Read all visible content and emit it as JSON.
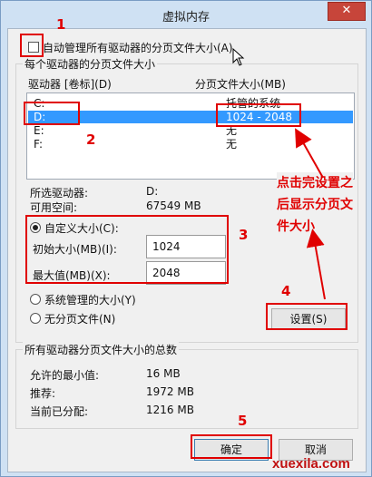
{
  "window": {
    "title": "虚拟内存",
    "close_label": "✕"
  },
  "auto_manage": {
    "label": "自动管理所有驱动器的分页文件大小(A)",
    "checked": false
  },
  "drive_group": {
    "title": "每个驱动器的分页文件大小",
    "col_drive": "驱动器 [卷标](D)",
    "col_size": "分页文件大小(MB)",
    "rows": [
      {
        "drive": "C:",
        "size": "托管的系统"
      },
      {
        "drive": "D:",
        "size": "1024 - 2048"
      },
      {
        "drive": "E:",
        "size": "无"
      },
      {
        "drive": "F:",
        "size": "无"
      }
    ],
    "selected_label": "所选驱动器:",
    "selected_value": "D:",
    "free_label": "可用空间:",
    "free_value": "67549 MB",
    "custom_label": "自定义大小(C):",
    "initial_label": "初始大小(MB)(I):",
    "initial_value": "1024",
    "max_label": "最大值(MB)(X):",
    "max_value": "2048",
    "system_label": "系统管理的大小(Y)",
    "none_label": "无分页文件(N)",
    "set_button": "设置(S)"
  },
  "totals_group": {
    "title": "所有驱动器分页文件大小的总数",
    "min_label": "允许的最小值:",
    "min_value": "16 MB",
    "recommended_label": "推荐:",
    "recommended_value": "1972 MB",
    "current_label": "当前已分配:",
    "current_value": "1216 MB"
  },
  "buttons": {
    "ok": "确定",
    "cancel": "取消"
  },
  "annotations": {
    "num1": "1",
    "num2": "2",
    "num3": "3",
    "num4": "4",
    "num5": "5",
    "note_line1": "点击完设置之",
    "note_line2": "后显示分页文",
    "note_line3": "件大小"
  },
  "watermark": "xuexila.com",
  "colors": {
    "annotation": "#e00000",
    "selection": "#3399ff",
    "close": "#c7453a"
  }
}
